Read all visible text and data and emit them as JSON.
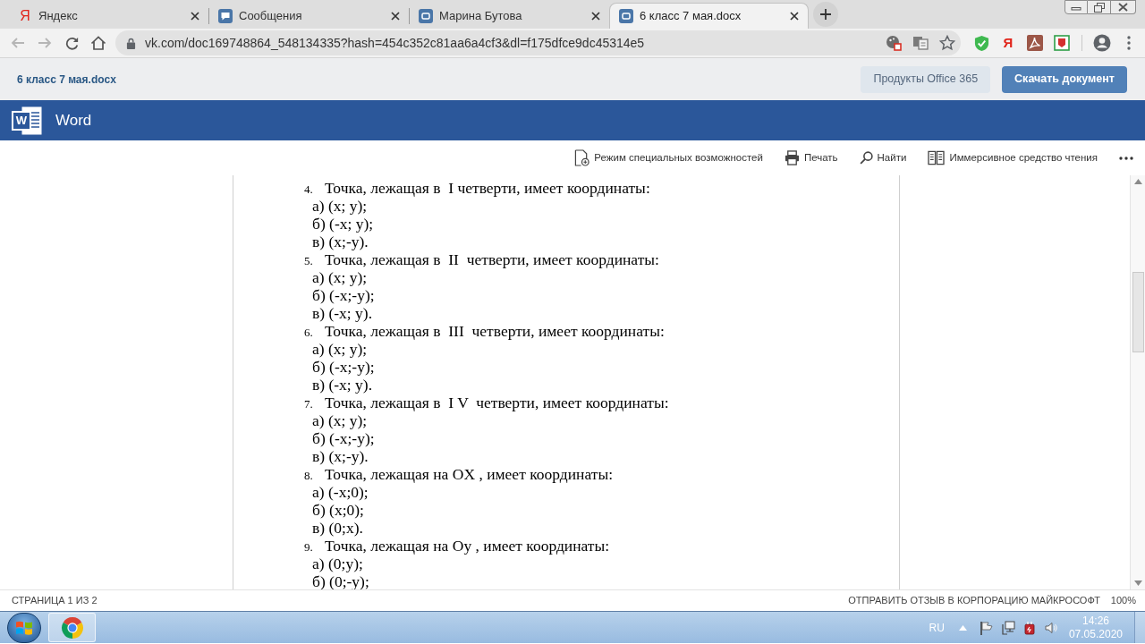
{
  "browser": {
    "tabs": [
      {
        "title": "Яндекс",
        "selected": false,
        "kind": "glyph",
        "glyph": "Я"
      },
      {
        "title": "Сообщения",
        "selected": false,
        "kind": "chat"
      },
      {
        "title": "Марина Бутова",
        "selected": false,
        "kind": "site"
      },
      {
        "title": "6 класс 7 мая.docx",
        "selected": true,
        "kind": "site"
      }
    ],
    "navigation": {
      "back_disabled": true,
      "forward_disabled": true
    },
    "address": "vk.com/doc169748864_548134335?hash=454c352c81aa6a4cf3&dl=f175dfce9dc45314e5",
    "extensions": [
      {
        "kind": "shield"
      },
      {
        "kind": "glyph",
        "glyph": "Я"
      },
      {
        "kind": "pdf"
      },
      {
        "kind": "badge"
      }
    ]
  },
  "doc_header": {
    "title": "6 класс 7 мая.docx",
    "buttons": [
      {
        "label": "Продукты Office 365",
        "kind": "secondary"
      },
      {
        "label": "Скачать документ",
        "kind": "primary"
      }
    ]
  },
  "app_bar": {
    "logo_letter": "W",
    "name": "Word"
  },
  "toolbar": [
    {
      "label": "Режим специальных возможностей",
      "kind": "accessibility"
    },
    {
      "label": "Печать",
      "kind": "print"
    },
    {
      "label": "Найти",
      "kind": "find"
    },
    {
      "label": "Иммерсивное средство чтения",
      "kind": "reader"
    },
    {
      "kind": "more"
    }
  ],
  "document": {
    "questions": [
      {
        "number": "4.",
        "text": "Точка, лежащая в  I четверти, имеет координаты:",
        "options": [
          "а) (x; y);",
          "б) (-x; y);",
          "в) (x;-y)."
        ]
      },
      {
        "number": "5.",
        "text": "Точка, лежащая в  II  четверти, имеет координаты:",
        "options": [
          "а) (x; y);",
          "б) (-x;-y);",
          "в) (-x; y)."
        ]
      },
      {
        "number": "6.",
        "text": "Точка, лежащая в  III  четверти, имеет координаты:",
        "options": [
          "а) (x; y);",
          "б) (-x;-y);",
          "в) (-x; y)."
        ]
      },
      {
        "number": "7.",
        "text": "Точка, лежащая в  I V  четверти, имеет координаты:",
        "options": [
          "а) (x; y);",
          "б) (-x;-y);",
          "в) (x;-y)."
        ]
      },
      {
        "number": "8.",
        "text": "Точка, лежащая на OX , имеет координаты:",
        "options": [
          "а) (-x;0);",
          "б) (x;0);",
          "в) (0;x)."
        ]
      },
      {
        "number": "9.",
        "text": "Точка, лежащая на Oy , имеет координаты:",
        "options": [
          "а) (0;y);",
          "б) (0;-y);"
        ]
      }
    ]
  },
  "status_bar": {
    "page": "СТРАНИЦА 1 ИЗ 2",
    "feedback": "ОТПРАВИТЬ ОТЗЫВ В КОРПОРАЦИЮ МАЙКРОСОФТ",
    "zoom": "100%"
  },
  "taskbar": {
    "language": "RU",
    "time": "14:26",
    "date": "07.05.2020"
  }
}
